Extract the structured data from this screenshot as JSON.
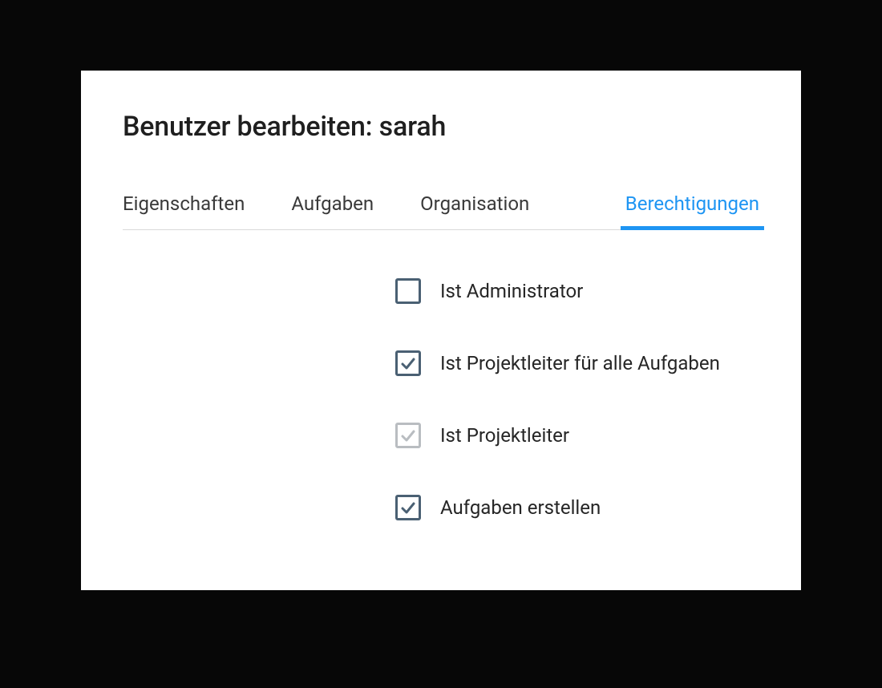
{
  "title": "Benutzer bearbeiten: sarah",
  "tabs": [
    {
      "label": "Eigenschaften",
      "active": false
    },
    {
      "label": "Aufgaben",
      "active": false
    },
    {
      "label": "Organisation",
      "active": false
    },
    {
      "label": "Berechtigungen",
      "active": true
    }
  ],
  "permissions": [
    {
      "label": "Ist Administrator",
      "checked": false,
      "disabled": false
    },
    {
      "label": "Ist Projektleiter für alle Aufgaben",
      "checked": true,
      "disabled": false
    },
    {
      "label": "Ist Projektleiter",
      "checked": true,
      "disabled": true
    },
    {
      "label": "Aufgaben erstellen",
      "checked": true,
      "disabled": false
    }
  ],
  "colors": {
    "accent": "#1e95f3",
    "checkbox": "#4a6073",
    "disabled": "#b9bdc1"
  }
}
